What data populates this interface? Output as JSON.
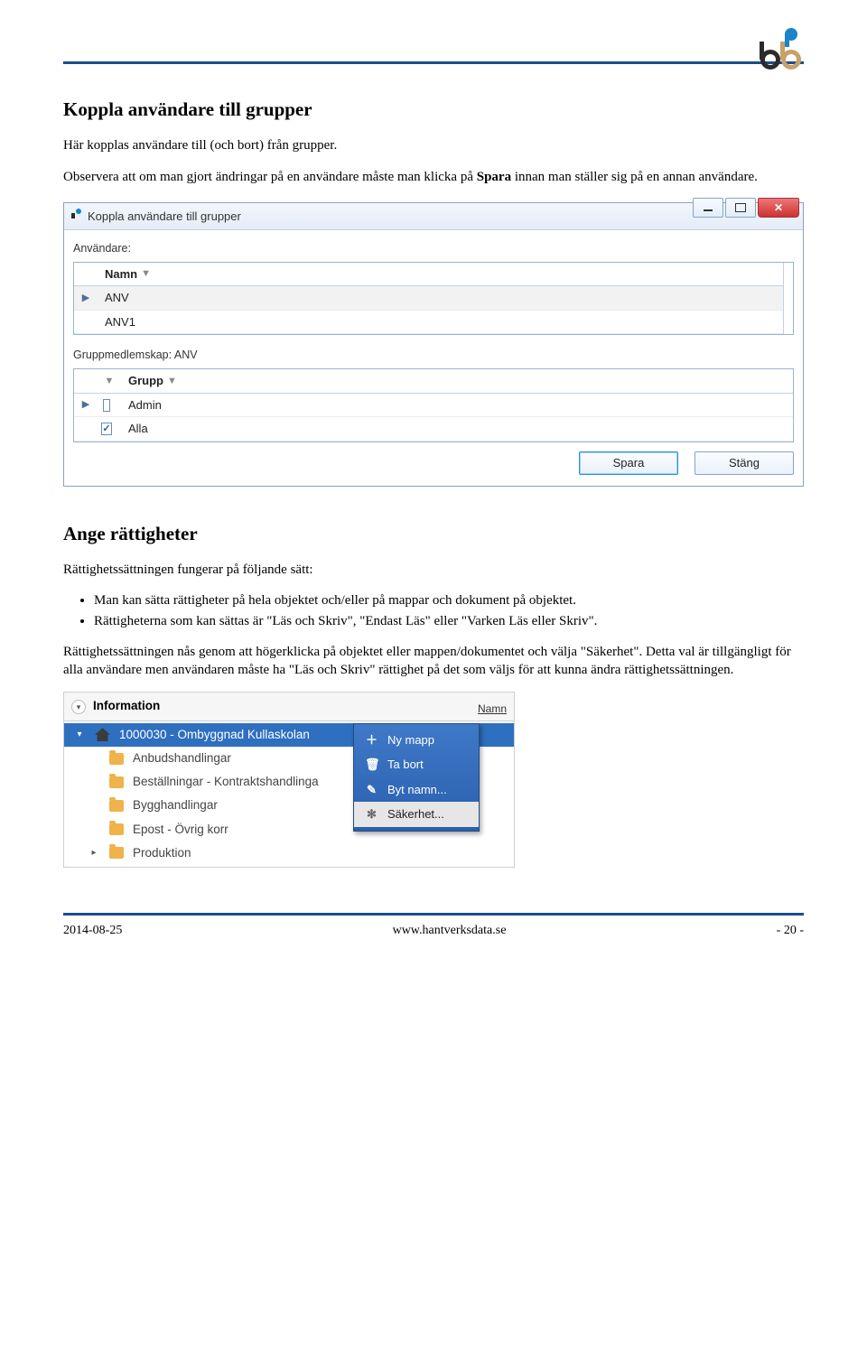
{
  "logo": {
    "alt": "Hantverksdata logo"
  },
  "section1": {
    "heading": "Koppla användare till grupper",
    "intro": "Här kopplas användare till (och bort) från grupper.",
    "notice_pre": "Observera att om man gjort ändringar på en användare måste man klicka på ",
    "notice_bold": "Spara",
    "notice_post": " innan man ställer sig på en annan användare."
  },
  "dialog": {
    "title": "Koppla användare till grupper",
    "label_user": "Användare:",
    "col_namn": "Namn",
    "rows_users": [
      "ANV",
      "ANV1"
    ],
    "label_groups_prefix": "Gruppmedlemskap: ",
    "label_groups_value": "ANV",
    "col_grupp": "Grupp",
    "rows_groups": [
      {
        "checked": false,
        "name": "Admin"
      },
      {
        "checked": true,
        "name": "Alla"
      }
    ],
    "btn_save": "Spara",
    "btn_close": "Stäng"
  },
  "section2": {
    "heading": "Ange rättigheter",
    "intro": "Rättighetssättningen fungerar på följande sätt:",
    "bullets": [
      "Man kan sätta rättigheter på hela objektet och/eller på mappar och dokument på objektet.",
      "Rättigheterna som kan sättas är \"Läs och Skriv\", \"Endast Läs\" eller \"Varken Läs eller Skriv\"."
    ],
    "para2": "Rättighetssättningen nås genom att högerklicka på objektet eller mappen/dokumentet och välja \"Säkerhet\". Detta val är tillgängligt för alla användare men användaren måste ha \"Läs och Skriv\" rättighet på det som väljs för att kunna ändra rättighetssättningen."
  },
  "tree": {
    "panel_title": "Information",
    "columns_hint": "Namn",
    "root": "1000030 - Ombyggnad Kullaskolan",
    "items": [
      "Anbudshandlingar",
      "Beställningar - Kontraktshandlinga",
      "Bygghandlingar",
      "Epost - Övrig korr",
      "Produktion"
    ],
    "context_menu": [
      {
        "icon": "plus",
        "label": "Ny mapp"
      },
      {
        "icon": "trash",
        "label": "Ta bort"
      },
      {
        "icon": "pen",
        "label": "Byt namn..."
      },
      {
        "icon": "gear",
        "label": "Säkerhet..."
      }
    ]
  },
  "footer": {
    "left": "2014-08-25",
    "mid": "www.hantverksdata.se",
    "right": "- 20 -"
  }
}
